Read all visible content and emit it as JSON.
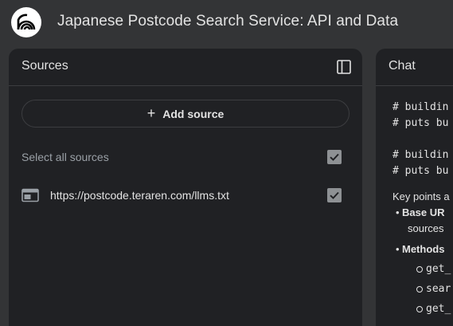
{
  "header": {
    "title": "Japanese Postcode Search Service: API and Data"
  },
  "sources": {
    "title": "Sources",
    "add_source_label": "Add source",
    "select_all_label": "Select all sources",
    "items": [
      {
        "label": "https://postcode.teraren.com/llms.txt",
        "checked": true
      }
    ]
  },
  "chat": {
    "title": "Chat",
    "code_lines": [
      "# buildin",
      "# puts bu",
      "",
      "# buildin",
      "# puts bu"
    ],
    "key_points": "Key points a",
    "bullets": [
      {
        "bold": "Base UR",
        "cont": "sources"
      },
      {
        "bold": "Methods",
        "sub": [
          "get_",
          "sear",
          "get_"
        ]
      }
    ]
  },
  "colors": {
    "background": "#333436",
    "panel": "#202124",
    "text": "#e3e3e3",
    "muted": "#9aa0a6",
    "checkbox": "#8e9194"
  }
}
